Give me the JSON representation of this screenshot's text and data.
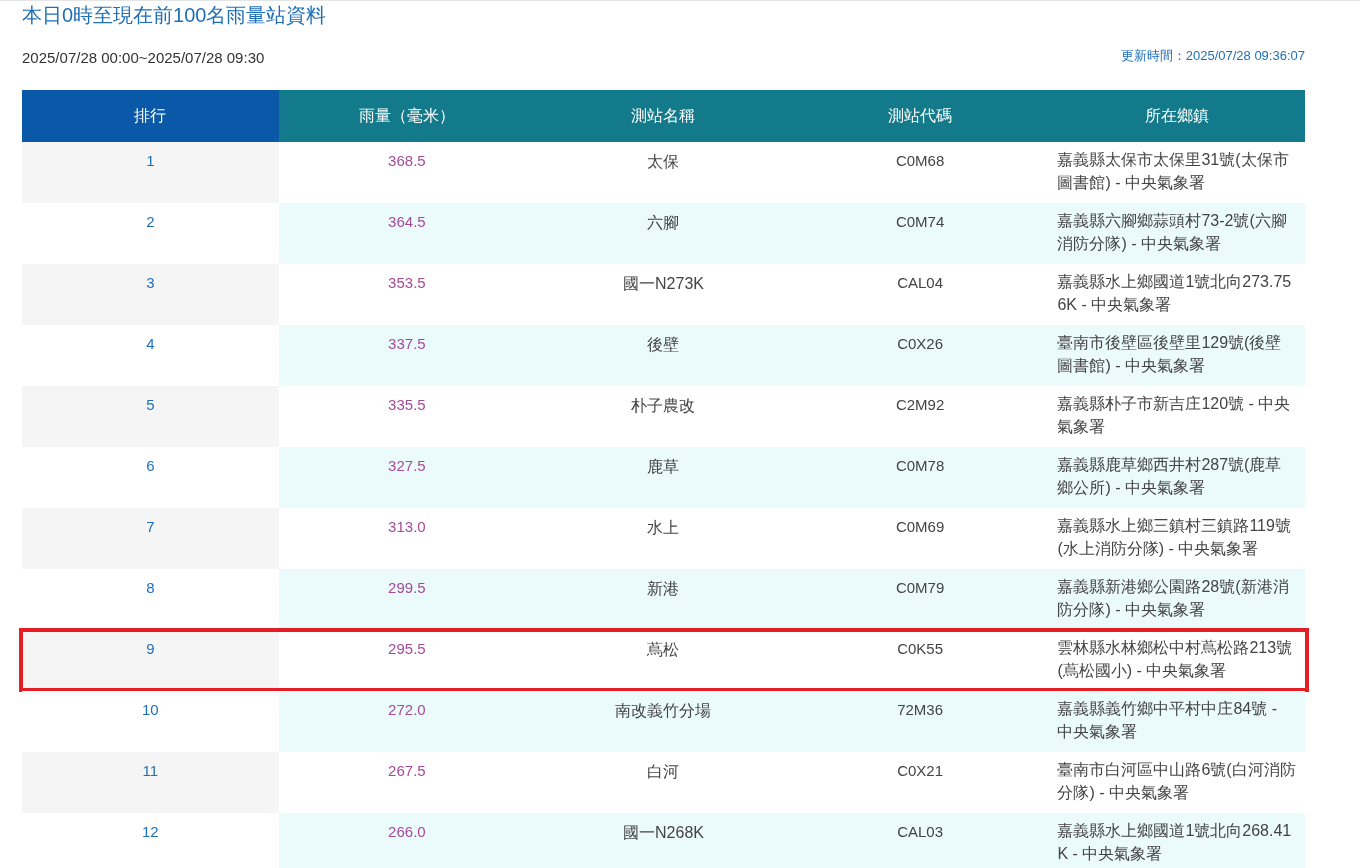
{
  "title": "本日0時至現在前100名雨量站資料",
  "period": "2025/07/28 00:00~2025/07/28 09:30",
  "updated": "更新時間：2025/07/28 09:36:07",
  "table": {
    "columns": [
      "排行",
      "雨量（毫米）",
      "測站名稱",
      "測站代碼",
      "所在鄉鎮"
    ],
    "rows": [
      {
        "rank": "1",
        "rainfall": "368.5",
        "name": "太保",
        "code": "C0M68",
        "town": "嘉義縣太保市太保里31號(太保市圖書館) - 中央氣象署",
        "highlighted": false
      },
      {
        "rank": "2",
        "rainfall": "364.5",
        "name": "六腳",
        "code": "C0M74",
        "town": "嘉義縣六腳鄉蒜頭村73-2號(六腳消防分隊) - 中央氣象署",
        "highlighted": false
      },
      {
        "rank": "3",
        "rainfall": "353.5",
        "name": "國一N273K",
        "code": "CAL04",
        "town": "嘉義縣水上鄉國道1號北向273.756K - 中央氣象署",
        "highlighted": false
      },
      {
        "rank": "4",
        "rainfall": "337.5",
        "name": "後壁",
        "code": "C0X26",
        "town": "臺南市後壁區後壁里129號(後壁圖書館) - 中央氣象署",
        "highlighted": false
      },
      {
        "rank": "5",
        "rainfall": "335.5",
        "name": "朴子農改",
        "code": "C2M92",
        "town": "嘉義縣朴子市新吉庄120號 - 中央氣象署",
        "highlighted": false
      },
      {
        "rank": "6",
        "rainfall": "327.5",
        "name": "鹿草",
        "code": "C0M78",
        "town": "嘉義縣鹿草鄉西井村287號(鹿草鄉公所) - 中央氣象署",
        "highlighted": false
      },
      {
        "rank": "7",
        "rainfall": "313.0",
        "name": "水上",
        "code": "C0M69",
        "town": "嘉義縣水上鄉三鎮村三鎮路119號(水上消防分隊) - 中央氣象署",
        "highlighted": false
      },
      {
        "rank": "8",
        "rainfall": "299.5",
        "name": "新港",
        "code": "C0M79",
        "town": "嘉義縣新港鄉公園路28號(新港消防分隊) - 中央氣象署",
        "highlighted": false
      },
      {
        "rank": "9",
        "rainfall": "295.5",
        "name": "蔦松",
        "code": "C0K55",
        "town": "雲林縣水林鄉松中村蔦松路213號(蔦松國小) - 中央氣象署",
        "highlighted": true
      },
      {
        "rank": "10",
        "rainfall": "272.0",
        "name": "南改義竹分場",
        "code": "72M36",
        "town": "嘉義縣義竹鄉中平村中庄84號 - 中央氣象署",
        "highlighted": false
      },
      {
        "rank": "11",
        "rainfall": "267.5",
        "name": "白河",
        "code": "C0X21",
        "town": "臺南市白河區中山路6號(白河消防分隊) - 中央氣象署",
        "highlighted": false
      },
      {
        "rank": "12",
        "rainfall": "266.0",
        "name": "國一N268K",
        "code": "CAL03",
        "town": "嘉義縣水上鄉國道1號北向268.41K - 中央氣象署",
        "highlighted": false
      }
    ]
  }
}
